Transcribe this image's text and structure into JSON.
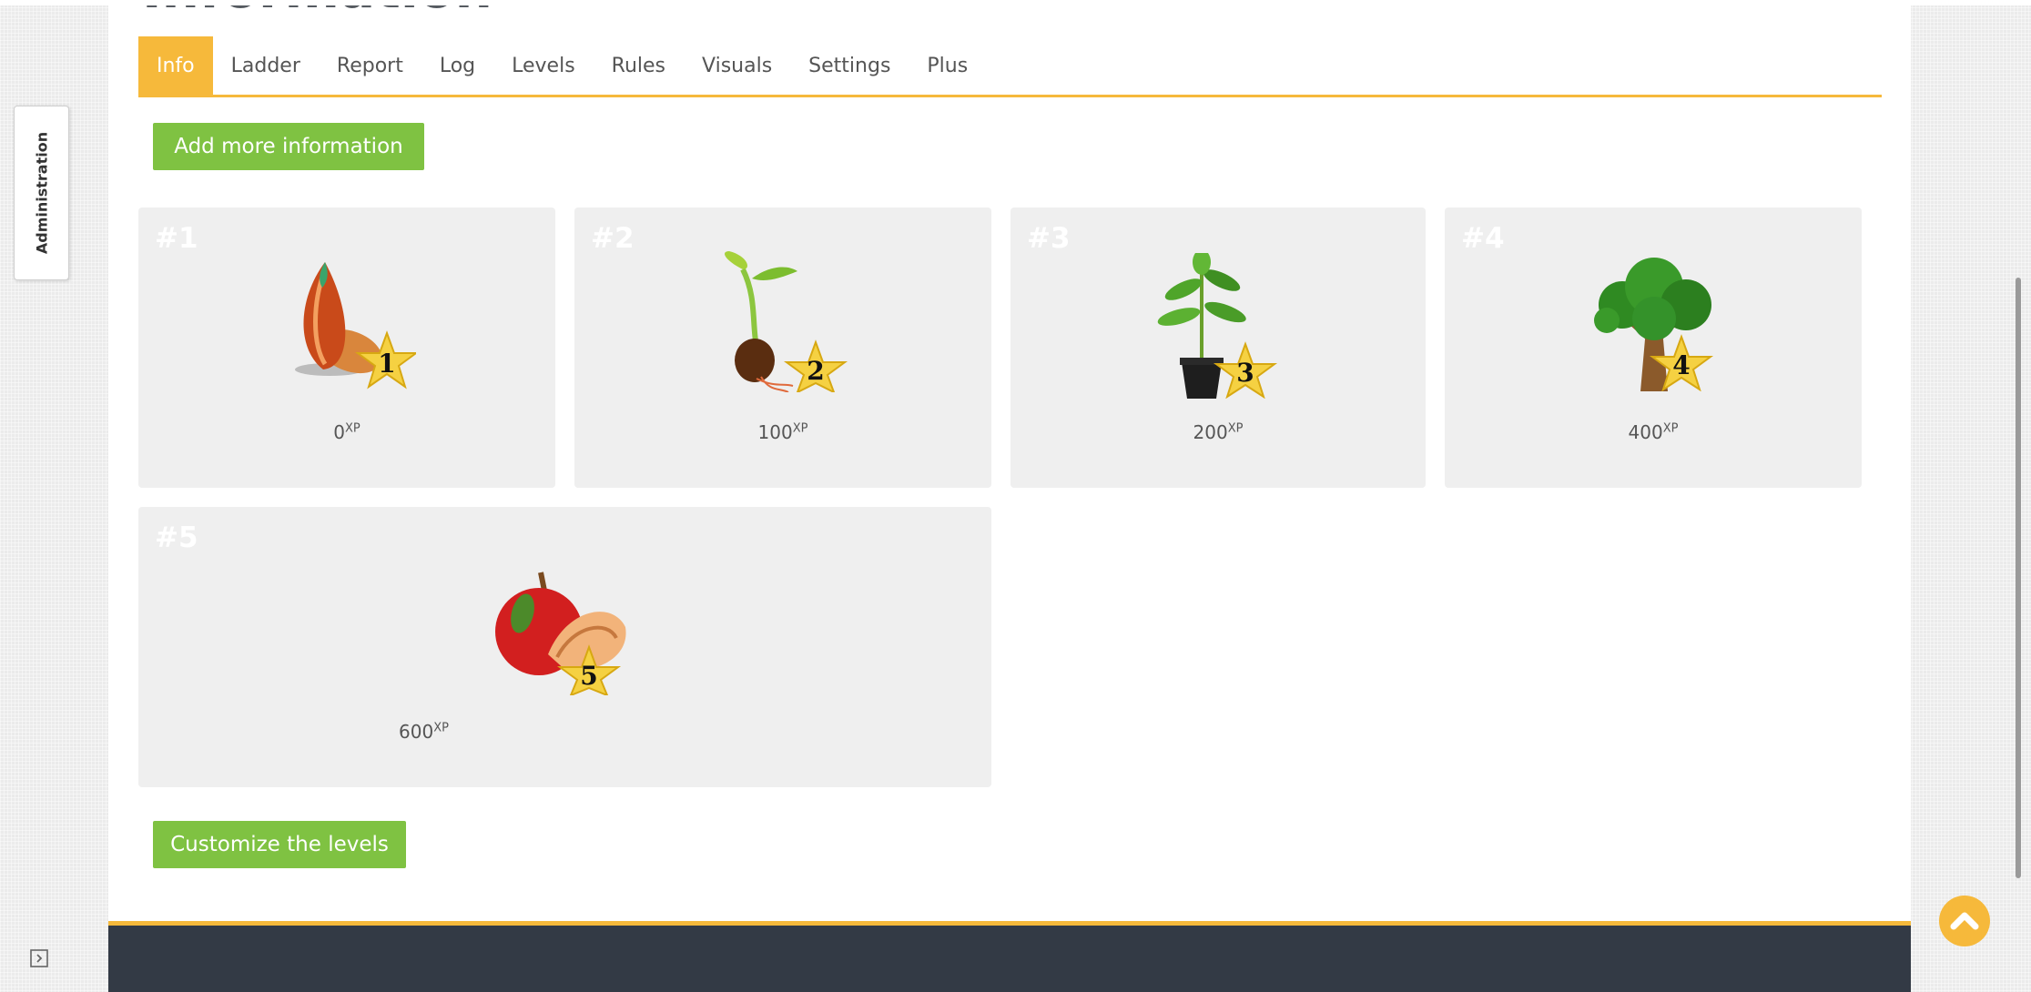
{
  "page": {
    "heading": "Information"
  },
  "tabs": [
    {
      "label": "Info",
      "active": true
    },
    {
      "label": "Ladder"
    },
    {
      "label": "Report"
    },
    {
      "label": "Log"
    },
    {
      "label": "Levels"
    },
    {
      "label": "Rules"
    },
    {
      "label": "Visuals"
    },
    {
      "label": "Settings"
    },
    {
      "label": "Plus"
    }
  ],
  "buttons": {
    "add_info": "Add more information",
    "customize": "Customize the levels"
  },
  "levels": [
    {
      "number": "#1",
      "xp": "0",
      "unit": "XP",
      "badge": "1",
      "icon": "seed-icon"
    },
    {
      "number": "#2",
      "xp": "100",
      "unit": "XP",
      "badge": "2",
      "icon": "sprout-icon"
    },
    {
      "number": "#3",
      "xp": "200",
      "unit": "XP",
      "badge": "3",
      "icon": "potted-plant-icon"
    },
    {
      "number": "#4",
      "xp": "400",
      "unit": "XP",
      "badge": "4",
      "icon": "tree-icon"
    },
    {
      "number": "#5",
      "xp": "600",
      "unit": "XP",
      "badge": "5",
      "icon": "apple-icon"
    }
  ],
  "sidebar": {
    "admin_label": "Administration"
  },
  "colors": {
    "accent": "#f6b93b",
    "button_green": "#7fc242",
    "footer": "#333a45",
    "card_bg": "#efefef"
  }
}
